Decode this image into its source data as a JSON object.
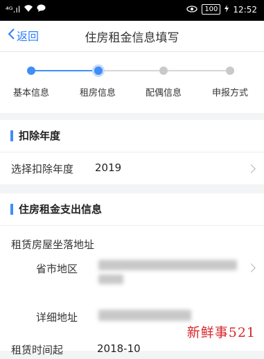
{
  "status_bar": {
    "signal": "⁴ᴳ.ıl",
    "network_icon": "wifi-icon",
    "message_icon": "message-icon",
    "eye_icon": "eye-icon",
    "battery": "100",
    "time": "12:52"
  },
  "nav": {
    "back_label": "返回",
    "title": "住房租金信息填写"
  },
  "steps": [
    {
      "label": "基本信息",
      "state": "done"
    },
    {
      "label": "租房信息",
      "state": "current"
    },
    {
      "label": "配偶信息",
      "state": "todo"
    },
    {
      "label": "申报方式",
      "state": "todo"
    }
  ],
  "deduction_year": {
    "section_title": "扣除年度",
    "label": "选择扣除年度",
    "value": "2019"
  },
  "rent_expense": {
    "section_title": "住房租金支出信息",
    "address_label": "租赁房屋坐落地址",
    "region_label": "省市地区",
    "detail_label": "详细地址",
    "period_label": "租赁时间起",
    "period_value": "2018-10"
  },
  "watermark": "新鲜事521",
  "colors": {
    "accent": "#3f8ef7",
    "watermark": "#d9262c"
  }
}
